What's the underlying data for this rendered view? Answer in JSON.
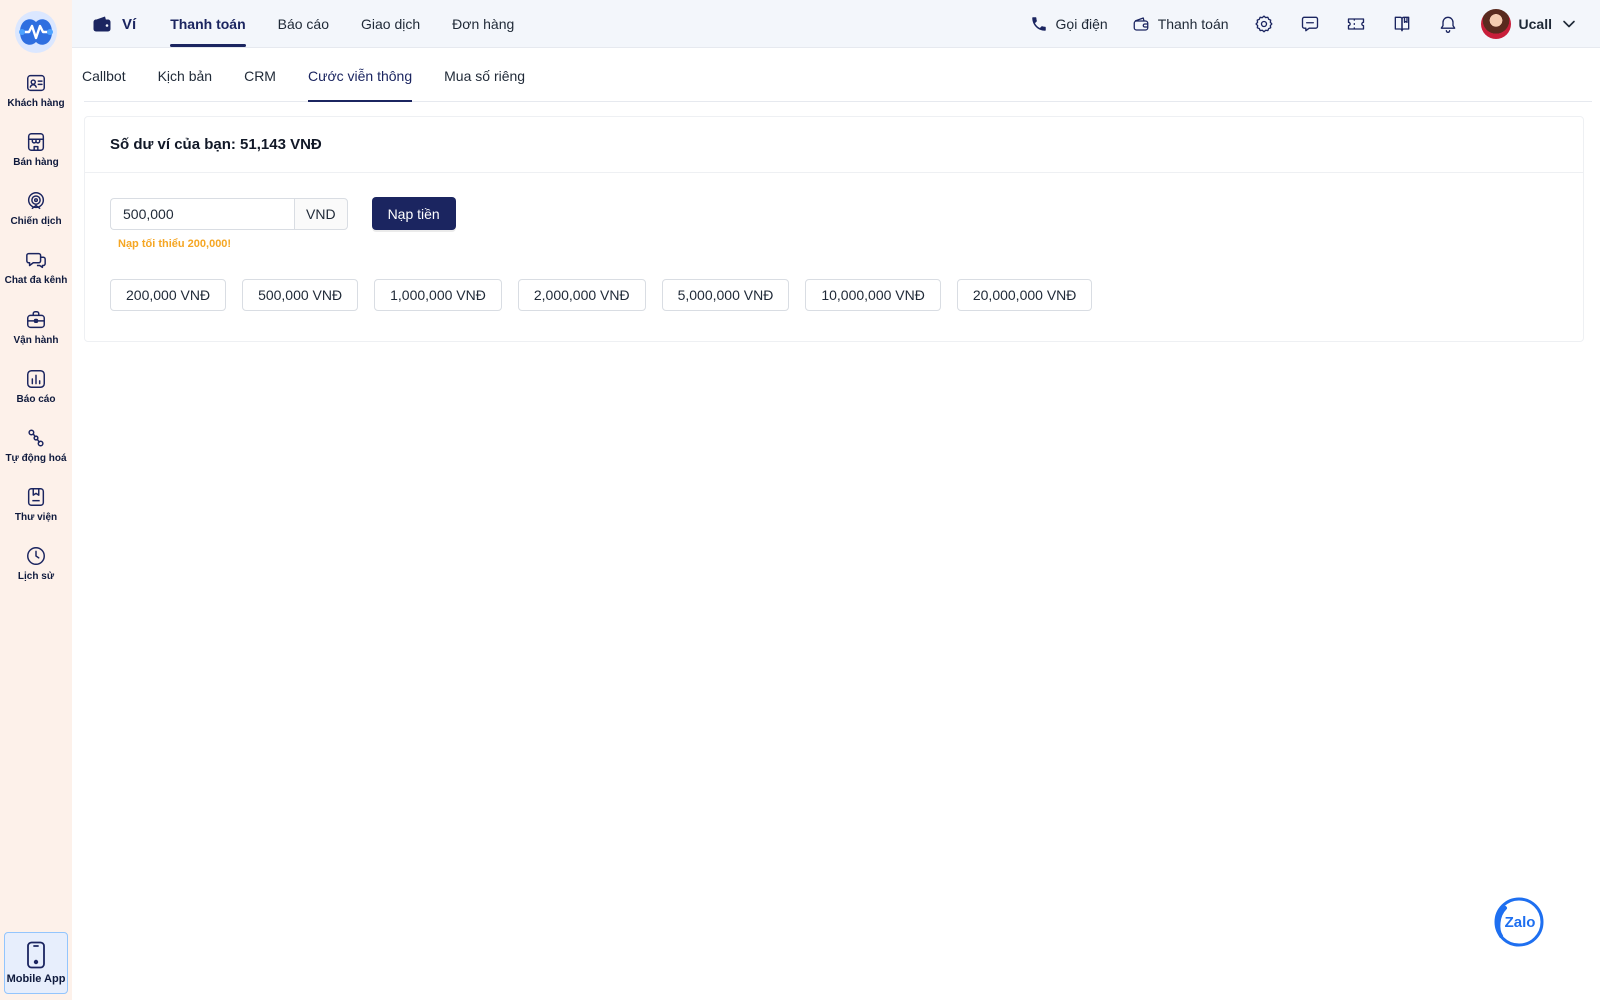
{
  "app": {
    "accent_color": "#1b2560",
    "sidebar_bg": "#fdf1ea",
    "warning_color": "#f5a623"
  },
  "sidebar": {
    "items": [
      {
        "label": "Khách hàng",
        "icon": "contact-card-icon"
      },
      {
        "label": "Bán hàng",
        "icon": "storefront-icon"
      },
      {
        "label": "Chiến dịch",
        "icon": "target-icon"
      },
      {
        "label": "Chat đa kênh",
        "icon": "chat-bubbles-icon"
      },
      {
        "label": "Vận hành",
        "icon": "briefcase-icon"
      },
      {
        "label": "Báo cáo",
        "icon": "bar-chart-icon"
      },
      {
        "label": "Tự động hoá",
        "icon": "workflow-icon"
      },
      {
        "label": "Thư viện",
        "icon": "bookmark-book-icon"
      },
      {
        "label": "Lịch sử",
        "icon": "clock-icon"
      }
    ],
    "mobile_app_label": "Mobile App"
  },
  "topbar": {
    "brand_label": "Ví",
    "tabs": [
      {
        "label": "Thanh toán",
        "active": true
      },
      {
        "label": "Báo cáo",
        "active": false
      },
      {
        "label": "Giao dịch",
        "active": false
      },
      {
        "label": "Đơn hàng",
        "active": false
      }
    ],
    "call_label": "Gọi điện",
    "payment_label": "Thanh toán",
    "icons": [
      "gear-icon",
      "message-icon",
      "ticket-icon",
      "book-icon",
      "bell-icon"
    ],
    "user_name": "Ucall"
  },
  "subtabs": [
    {
      "label": "Callbot",
      "active": false
    },
    {
      "label": "Kịch bản",
      "active": false
    },
    {
      "label": "CRM",
      "active": false
    },
    {
      "label": "Cước viễn thông",
      "active": true
    },
    {
      "label": "Mua số riêng",
      "active": false
    }
  ],
  "wallet": {
    "balance_text": "Số dư ví của bạn: 51,143 VNĐ",
    "amount_value": "500,000",
    "currency_label": "VND",
    "topup_label": "Nạp tiền",
    "min_hint": "Nạp tối thiểu 200,000!",
    "presets": [
      "200,000 VNĐ",
      "500,000 VNĐ",
      "1,000,000 VNĐ",
      "2,000,000 VNĐ",
      "5,000,000 VNĐ",
      "10,000,000 VNĐ",
      "20,000,000 VNĐ"
    ]
  },
  "zalo": {
    "label": "Zalo"
  }
}
